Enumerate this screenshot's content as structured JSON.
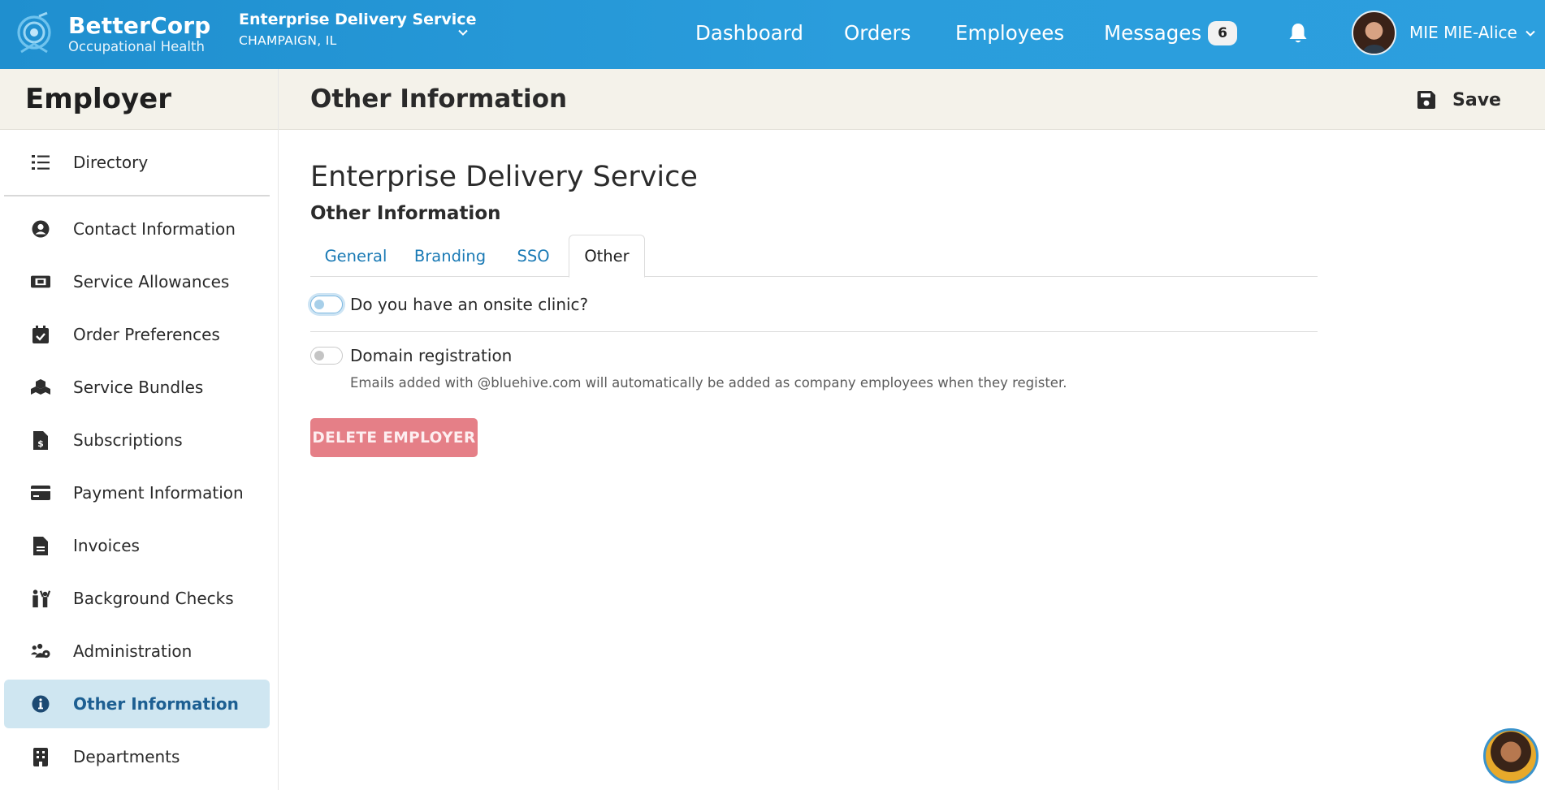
{
  "brand": {
    "name": "BetterCorp",
    "subtitle": "Occupational Health"
  },
  "company_selector": {
    "name": "Enterprise Delivery Service",
    "location": "CHAMPAIGN, IL"
  },
  "nav": {
    "links": [
      "Dashboard",
      "Orders",
      "Employees",
      "Messages"
    ],
    "messages_count": "6",
    "user_name": "MIE MIE-Alice"
  },
  "sidebar": {
    "title": "Employer",
    "items": [
      {
        "label": "Directory",
        "icon": "list-icon"
      },
      {
        "label": "Contact Information",
        "icon": "user-circle-icon"
      },
      {
        "label": "Service Allowances",
        "icon": "ticket-icon"
      },
      {
        "label": "Order Preferences",
        "icon": "calendar-check-icon"
      },
      {
        "label": "Service Bundles",
        "icon": "cubes-icon"
      },
      {
        "label": "Subscriptions",
        "icon": "file-invoice-dollar-icon"
      },
      {
        "label": "Payment Information",
        "icon": "credit-card-icon"
      },
      {
        "label": "Invoices",
        "icon": "file-icon"
      },
      {
        "label": "Background Checks",
        "icon": "people-icon"
      },
      {
        "label": "Administration",
        "icon": "users-gear-icon"
      },
      {
        "label": "Other Information",
        "icon": "info-circle-icon",
        "active": true
      },
      {
        "label": "Departments",
        "icon": "building-icon"
      }
    ]
  },
  "main": {
    "title": "Other Information",
    "save_label": "Save",
    "company_heading": "Enterprise Delivery Service",
    "section_heading": "Other Information",
    "tabs": [
      "General",
      "Branding",
      "SSO",
      "Other"
    ],
    "active_tab": "Other",
    "options": {
      "onsite_clinic_label": "Do you have an onsite clinic?",
      "onsite_clinic_checked": false,
      "domain_registration_label": "Domain registration",
      "domain_registration_checked": false,
      "domain_registration_help": "Emails added with @bluehive.com will automatically be added as company employees when they register."
    },
    "delete_button": "DELETE EMPLOYER"
  },
  "colors": {
    "header_blue": "#2a9ddc",
    "sidebar_header_bg": "#f4f2ea",
    "active_item_bg": "#cfe6f1",
    "link_blue": "#1a7ab5",
    "delete_red": "#e57f87"
  }
}
